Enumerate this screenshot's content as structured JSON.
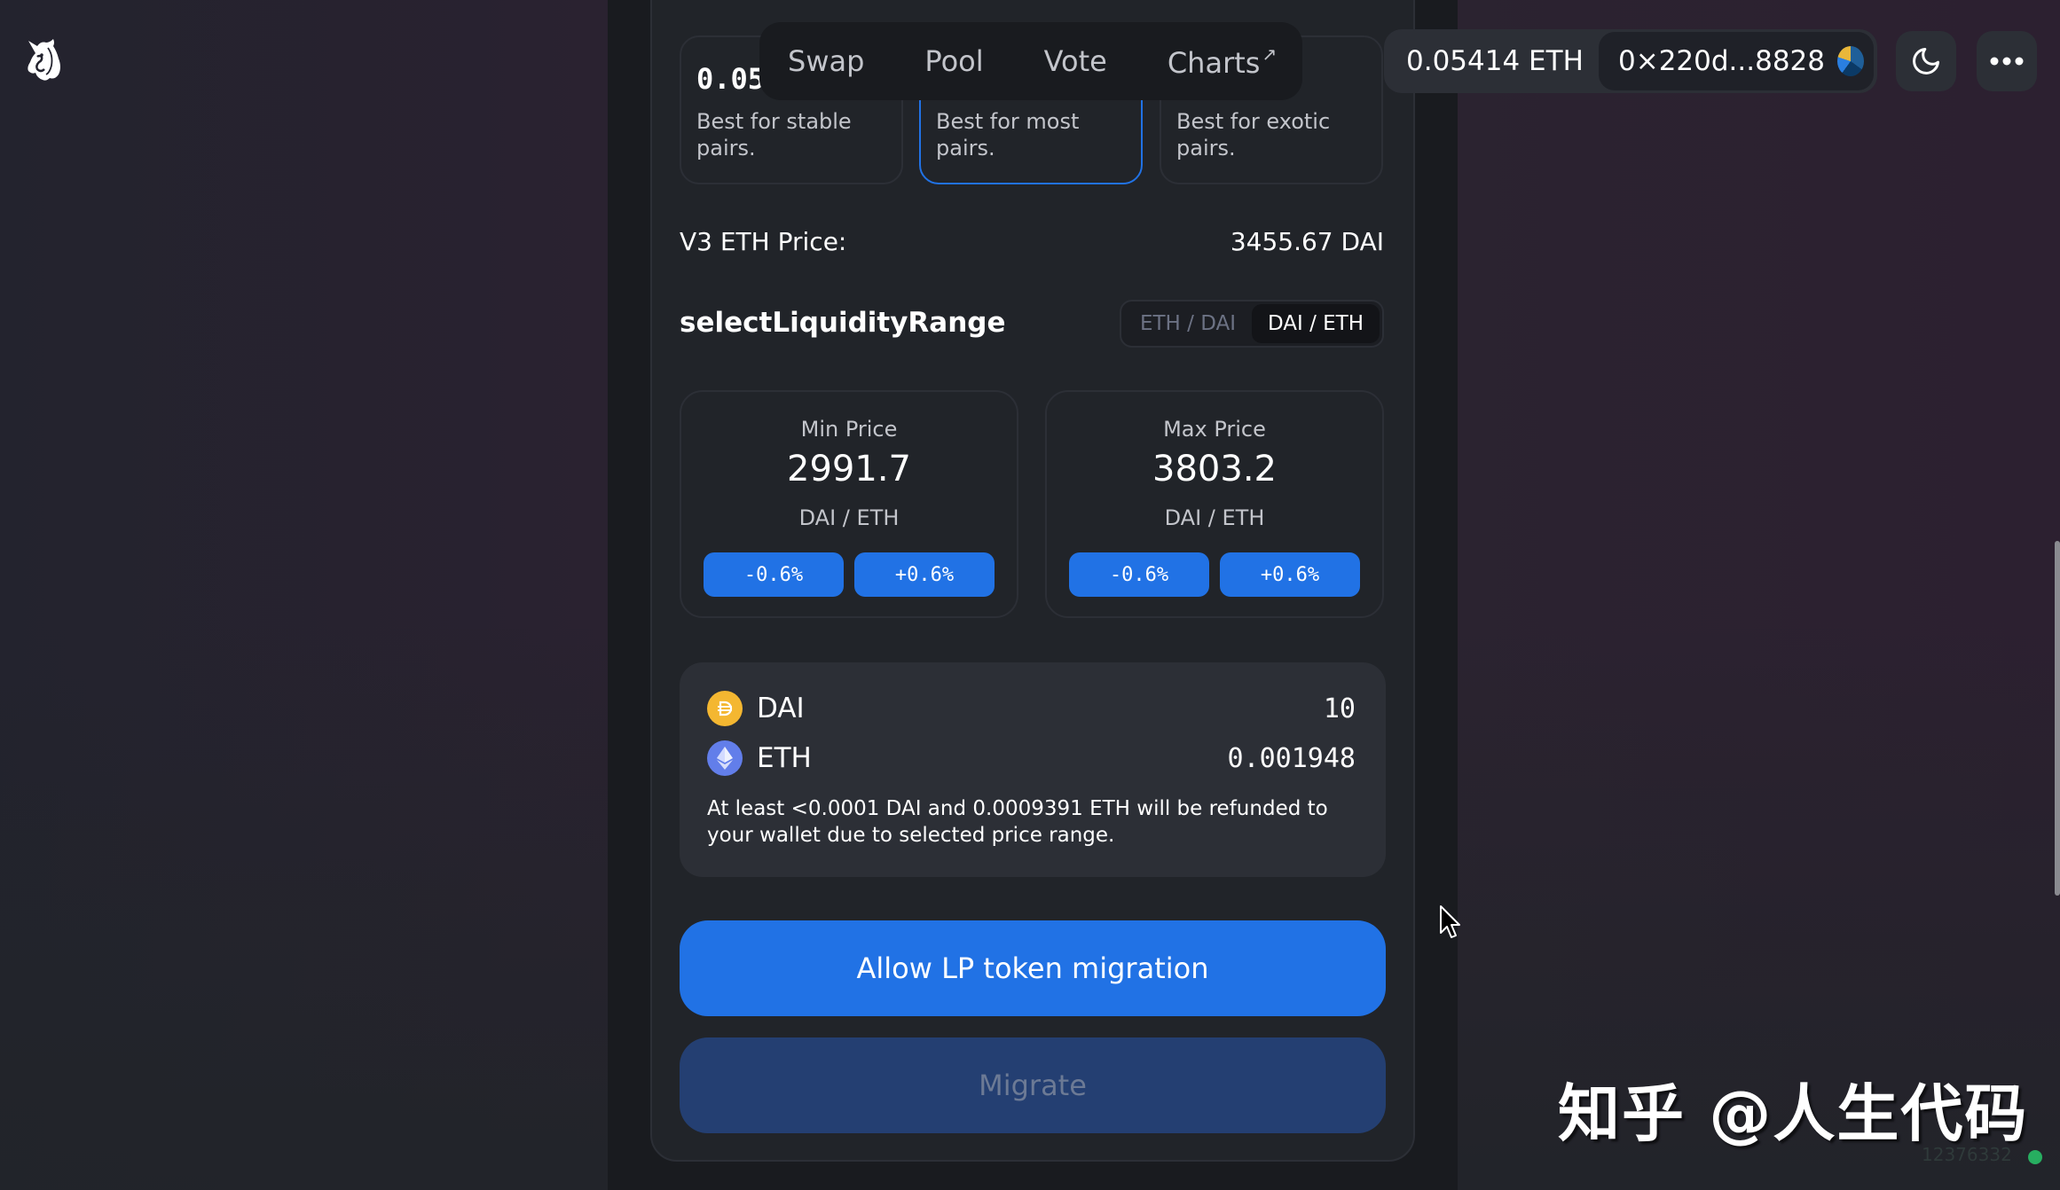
{
  "app": {
    "logo": "uniswap-unicorn-icon"
  },
  "nav": {
    "items": [
      {
        "label": "Swap"
      },
      {
        "label": "Pool"
      },
      {
        "label": "Vote"
      },
      {
        "label": "Charts",
        "external_icon": "↗"
      }
    ]
  },
  "account": {
    "balance": "0.05414 ETH",
    "address": "0×220d...8828",
    "theme_icon": "moon-icon",
    "menu_icon": "more-dots-icon"
  },
  "fee_tiers": [
    {
      "value": "0.05",
      "description": "Best for stable pairs.",
      "selected": false
    },
    {
      "value": "",
      "description": "Best for most pairs.",
      "selected": true
    },
    {
      "value": "",
      "description": "Best for exotic pairs.",
      "selected": false
    }
  ],
  "price": {
    "label": "V3 ETH Price:",
    "value": "3455.67 DAI"
  },
  "range": {
    "title": "selectLiquidityRange",
    "toggle": [
      {
        "label": "ETH / DAI",
        "active": false
      },
      {
        "label": "DAI / ETH",
        "active": true
      }
    ],
    "min": {
      "label": "Min Price",
      "value": "2991.7",
      "unit": "DAI / ETH",
      "dec": "-0.6%",
      "inc": "+0.6%"
    },
    "max": {
      "label": "Max Price",
      "value": "3803.2",
      "unit": "DAI / ETH",
      "dec": "-0.6%",
      "inc": "+0.6%"
    }
  },
  "tokens": [
    {
      "symbol": "DAI",
      "amount": "10",
      "icon": "dai-coin-icon",
      "color": "#f4b731"
    },
    {
      "symbol": "ETH",
      "amount": "0.001948",
      "icon": "eth-coin-icon",
      "color": "#627eea"
    }
  ],
  "refund_note": "At least <0.0001 DAI and 0.0009391 ETH will be refunded to your wallet due to selected price range.",
  "buttons": {
    "allow": "Allow LP token migration",
    "migrate": "Migrate"
  },
  "watermark": "知乎 @人生代码",
  "block_number": "12376332",
  "colors": {
    "accent": "#2172e5",
    "background": "#191b1f",
    "card": "#212429",
    "border": "#2c2f36",
    "disabled_button": "#243f72",
    "status_ok": "#27ae60"
  }
}
